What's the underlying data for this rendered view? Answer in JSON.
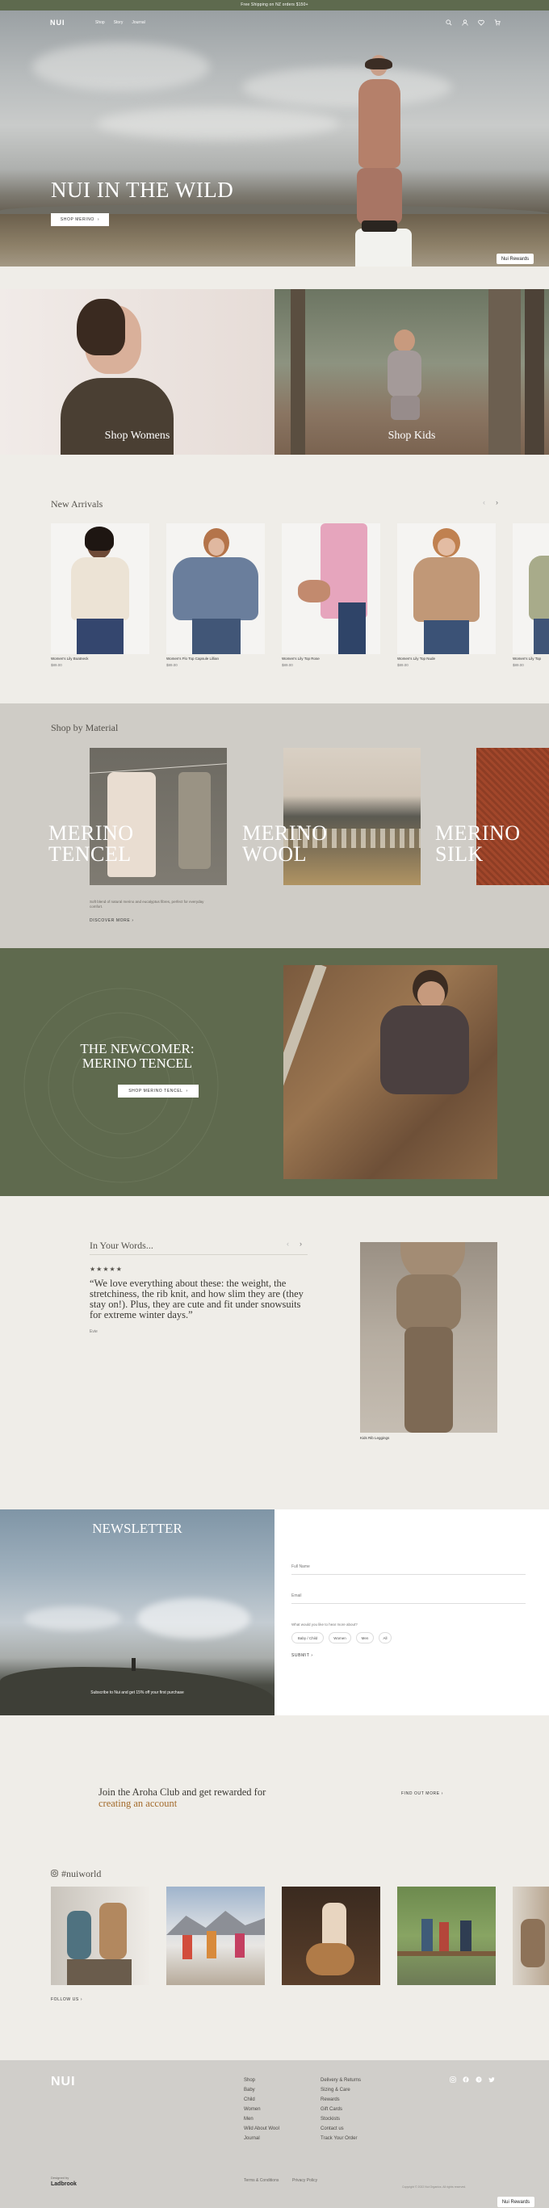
{
  "announcement": "Free Shipping on NZ orders $150+",
  "header": {
    "logo": "NUI",
    "nav": [
      "Shop",
      "Story",
      "Journal"
    ],
    "icons": [
      "search-icon",
      "account-icon",
      "wishlist-icon",
      "cart-icon"
    ]
  },
  "hero": {
    "title": "NUI IN THE WILD",
    "button": "SHOP MERINO",
    "rewards": "Nui Rewards"
  },
  "promos": [
    {
      "label": "Shop Womens"
    },
    {
      "label": "Shop Kids"
    }
  ],
  "new_arrivals": {
    "title": "New Arrivals",
    "products": [
      {
        "name": "Women's Lily Boatneck",
        "price": "$89.00"
      },
      {
        "name": "Women's Flo Top Capsule Lillian",
        "price": "$89.00"
      },
      {
        "name": "Women's Lily Top Rose",
        "price": "$89.00"
      },
      {
        "name": "Women's Lily Top Nude",
        "price": "$89.00"
      },
      {
        "name": "Women's Lily Top",
        "price": "$89.00"
      }
    ]
  },
  "materials": {
    "title": "Shop by Material",
    "items": [
      {
        "label_line1": "MERINO",
        "label_line2": "TENCEL"
      },
      {
        "label_line1": "MERINO",
        "label_line2": "WOOL"
      },
      {
        "label_line1": "MERINO",
        "label_line2": "SILK"
      }
    ],
    "description": "Soft blend of natural merino and eucalyptus fibres, perfect for everyday comfort.",
    "link": "DISCOVER MORE"
  },
  "newcomer": {
    "line1": "THE NEWCOMER:",
    "line2": "MERINO TENCEL",
    "button": "SHOP MERINO TENCEL"
  },
  "testimonial": {
    "title": "In Your Words...",
    "stars": "★★★★★",
    "quote": "“We love everything about these: the weight, the stretchiness, the rib knit, and how slim they are (they stay on!). Plus, they are cute and fit under snowsuits for extreme winter days.”",
    "author": "Evie",
    "product_caption": "Kids Rib Leggings"
  },
  "newsletter": {
    "title": "NEWSLETTER",
    "subtitle": "Subscribe to Nui and get 15% off your first purchase",
    "fields": {
      "name": "Full Name",
      "email": "Email"
    },
    "question": "What would you like to hear more about?",
    "options": [
      "Baby / Child",
      "Women",
      "Men",
      "All"
    ],
    "submit": "SUBMIT"
  },
  "aroha": {
    "line1": "Join the Aroha Club and get rewarded for",
    "line2": "creating an account",
    "link": "FIND OUT MORE"
  },
  "instagram": {
    "handle": "#nuiworld",
    "link": "FOLLOW US"
  },
  "footer": {
    "logo": "NUI",
    "col1": [
      "Shop",
      "Baby",
      "Child",
      "Women",
      "Men",
      "Wild About Wool",
      "Journal"
    ],
    "col2": [
      "Delivery & Returns",
      "Sizing & Care",
      "Rewards",
      "Gift Cards",
      "Stockists",
      "Contact us",
      "Track Your Order"
    ],
    "social_icons": [
      "instagram-icon",
      "facebook-icon",
      "pinterest-icon",
      "twitter-icon"
    ],
    "legal": [
      "Terms & Conditions",
      "Privacy Policy"
    ],
    "designed_by_label": "Designed by",
    "designed_by": "Ladbrook",
    "copyright": "Copyright © 2022 Nui Organics. All rights reserved."
  },
  "colors": {
    "olive": "#5f6a4e",
    "accent": "#a36b2c"
  }
}
